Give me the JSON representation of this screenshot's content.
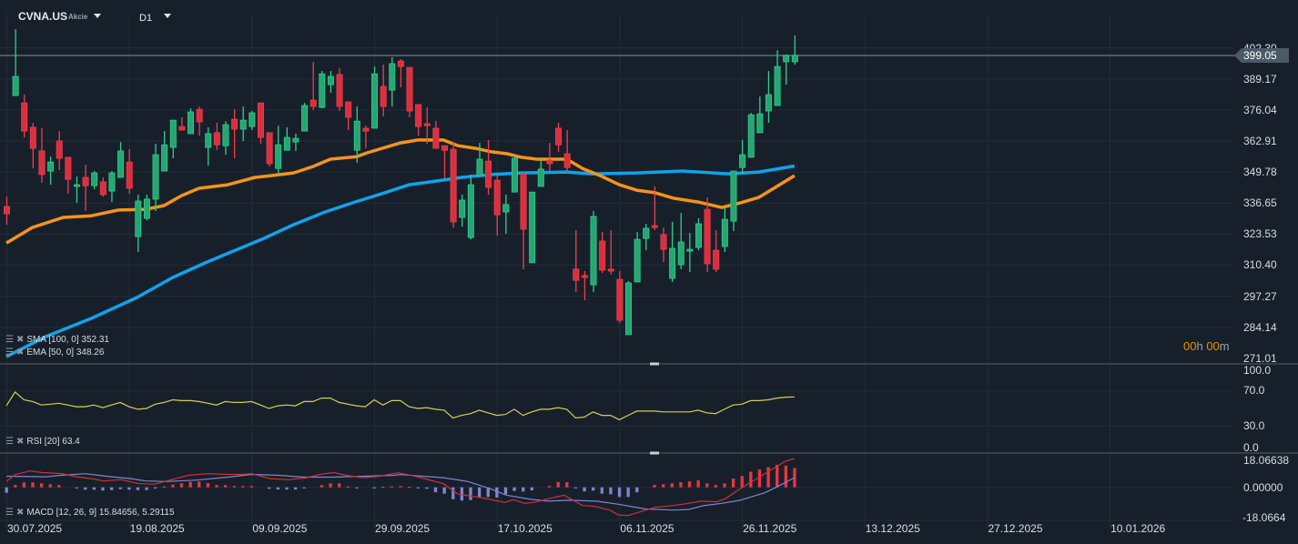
{
  "header": {
    "symbol": "CVNA.US",
    "type": "Akcie",
    "timeframe": "D1"
  },
  "current_price": "399.05",
  "timer": {
    "hours": "00",
    "h": "h",
    "minutes": "00",
    "m": "m"
  },
  "legends": {
    "sma": "SMA [100, 0] 352.31",
    "ema": "EMA [50, 0] 348.26",
    "rsi": "RSI [20] 63.4",
    "macd": "MACD [12, 26, 9] 15.84656,  5.29115"
  },
  "colors": {
    "bg": "#17202a",
    "up": "#26a673",
    "down": "#d9303f",
    "ema": "#f7931a",
    "sma": "#0fa3ec",
    "rsi": "#d6cc5a",
    "macd": "#d32f3a",
    "signal": "#7f86d0"
  },
  "chart_data": {
    "type": "candlestick",
    "title": "CVNA.US D1",
    "price_axis": {
      "ticks": [
        "402.30",
        "389.17",
        "376.04",
        "362.91",
        "349.78",
        "336.65",
        "323.53",
        "310.40",
        "297.27",
        "284.14",
        "271.01"
      ],
      "range": [
        271.01,
        402.3
      ]
    },
    "x_axis": {
      "labels": [
        {
          "i": 0,
          "label": "30.07.2025"
        },
        {
          "i": 14,
          "label": "19.08.2025"
        },
        {
          "i": 28,
          "label": "09.09.2025"
        },
        {
          "i": 42,
          "label": "29.09.2025"
        },
        {
          "i": 56,
          "label": "17.10.2025"
        },
        {
          "i": 70,
          "label": "06.11.2025"
        },
        {
          "i": 84,
          "label": "26.11.2025"
        },
        {
          "i": 98,
          "label": "13.12.2025"
        },
        {
          "i": 112,
          "label": "27.12.2025"
        },
        {
          "i": 126,
          "label": "10.01.2026"
        }
      ]
    },
    "ohlc": [
      [
        335.2,
        339.4,
        327.5,
        332.1
      ],
      [
        382.1,
        410.2,
        382.1,
        390.2
      ],
      [
        379.0,
        382.5,
        364.4,
        367.1
      ],
      [
        368.7,
        370.6,
        351.3,
        359.8
      ],
      [
        358.7,
        368.3,
        345.2,
        348.7
      ],
      [
        350.2,
        356.3,
        344.4,
        354.0
      ],
      [
        362.9,
        367.1,
        350.6,
        355.6
      ],
      [
        356.0,
        356.0,
        340.6,
        346.7
      ],
      [
        343.7,
        347.9,
        336.7,
        344.4
      ],
      [
        347.5,
        352.9,
        333.3,
        344.0
      ],
      [
        344.0,
        350.2,
        342.5,
        349.4
      ],
      [
        345.6,
        347.5,
        339.4,
        340.2
      ],
      [
        341.7,
        350.2,
        337.1,
        349.4
      ],
      [
        347.5,
        362.5,
        347.5,
        358.7
      ],
      [
        354.0,
        359.4,
        340.6,
        342.9
      ],
      [
        322.5,
        340.2,
        316.0,
        337.5
      ],
      [
        330.2,
        340.2,
        329.4,
        338.3
      ],
      [
        338.3,
        361.7,
        333.3,
        357.1
      ],
      [
        350.2,
        367.1,
        350.2,
        361.3
      ],
      [
        360.2,
        371.7,
        355.6,
        371.7
      ],
      [
        369.0,
        372.9,
        367.5,
        367.5
      ],
      [
        366.0,
        376.7,
        366.0,
        375.2
      ],
      [
        376.3,
        377.5,
        365.2,
        371.0
      ],
      [
        360.2,
        368.7,
        352.5,
        366.0
      ],
      [
        366.4,
        370.6,
        359.0,
        361.3
      ],
      [
        360.9,
        371.3,
        357.1,
        369.8
      ],
      [
        372.1,
        376.3,
        355.6,
        367.9
      ],
      [
        367.9,
        377.5,
        362.9,
        371.7
      ],
      [
        369.0,
        375.6,
        367.5,
        374.8
      ],
      [
        379.0,
        379.0,
        361.7,
        364.4
      ],
      [
        366.4,
        366.4,
        352.1,
        353.3
      ],
      [
        351.3,
        369.4,
        348.7,
        361.3
      ],
      [
        359.0,
        368.7,
        359.0,
        364.4
      ],
      [
        362.5,
        366.0,
        358.7,
        364.0
      ],
      [
        367.1,
        379.0,
        367.1,
        377.9
      ],
      [
        380.2,
        396.3,
        376.0,
        377.5
      ],
      [
        377.1,
        392.5,
        376.7,
        391.3
      ],
      [
        386.7,
        392.5,
        383.3,
        390.2
      ],
      [
        391.0,
        393.7,
        375.6,
        377.5
      ],
      [
        379.4,
        379.4,
        367.5,
        372.9
      ],
      [
        359.0,
        377.5,
        353.7,
        371.3
      ],
      [
        368.3,
        369.4,
        359.8,
        367.1
      ],
      [
        368.3,
        394.4,
        368.3,
        391.3
      ],
      [
        386.0,
        395.2,
        373.3,
        377.5
      ],
      [
        384.4,
        398.3,
        377.5,
        395.6
      ],
      [
        396.7,
        397.5,
        385.6,
        394.4
      ],
      [
        394.0,
        394.0,
        372.9,
        375.6
      ],
      [
        378.3,
        378.3,
        365.2,
        369.0
      ],
      [
        370.2,
        377.1,
        361.7,
        369.4
      ],
      [
        368.3,
        371.3,
        359.8,
        359.8
      ],
      [
        360.9,
        360.9,
        347.1,
        359.0
      ],
      [
        359.4,
        362.5,
        326.3,
        328.7
      ],
      [
        330.6,
        340.2,
        326.7,
        337.9
      ],
      [
        322.1,
        348.7,
        321.3,
        344.4
      ],
      [
        348.3,
        362.1,
        348.3,
        355.2
      ],
      [
        354.4,
        363.3,
        340.2,
        343.3
      ],
      [
        346.3,
        348.3,
        322.9,
        331.7
      ],
      [
        332.9,
        340.2,
        323.7,
        336.0
      ],
      [
        341.3,
        356.7,
        341.3,
        355.6
      ],
      [
        349.0,
        349.0,
        308.7,
        325.6
      ],
      [
        311.4,
        341.3,
        311.4,
        341.3
      ],
      [
        343.7,
        356.0,
        343.7,
        351.0
      ],
      [
        354.8,
        362.1,
        350.2,
        353.3
      ],
      [
        368.3,
        370.6,
        358.3,
        361.3
      ],
      [
        357.5,
        367.5,
        349.4,
        351.7
      ],
      [
        308.7,
        325.2,
        299.0,
        304.0
      ],
      [
        306.0,
        307.9,
        295.6,
        305.2
      ],
      [
        302.1,
        333.3,
        299.0,
        331.0
      ],
      [
        320.6,
        324.4,
        307.1,
        308.3
      ],
      [
        308.7,
        325.2,
        306.4,
        307.9
      ],
      [
        304.4,
        307.9,
        286.0,
        287.1
      ],
      [
        281.0,
        303.7,
        281.0,
        302.9
      ],
      [
        303.3,
        324.4,
        303.3,
        321.3
      ],
      [
        321.7,
        327.9,
        316.7,
        326.0
      ],
      [
        327.1,
        343.7,
        325.2,
        326.3
      ],
      [
        323.3,
        326.3,
        311.7,
        317.1
      ],
      [
        304.8,
        328.7,
        303.3,
        317.5
      ],
      [
        310.6,
        332.5,
        308.7,
        320.2
      ],
      [
        316.3,
        324.0,
        307.5,
        317.1
      ],
      [
        317.9,
        330.2,
        316.7,
        327.9
      ],
      [
        334.0,
        339.0,
        307.5,
        311.0
      ],
      [
        316.7,
        325.2,
        307.5,
        308.7
      ],
      [
        318.3,
        334.4,
        316.0,
        329.8
      ],
      [
        329.0,
        350.2,
        324.8,
        350.2
      ],
      [
        351.7,
        363.3,
        349.0,
        357.1
      ],
      [
        356.0,
        374.8,
        356.0,
        374.0
      ],
      [
        366.4,
        381.7,
        366.4,
        374.4
      ],
      [
        375.6,
        392.5,
        370.6,
        382.5
      ],
      [
        377.9,
        401.3,
        377.9,
        394.4
      ],
      [
        396.4,
        399.5,
        386.7,
        399.05
      ],
      [
        396.4,
        407.5,
        395.2,
        399.05
      ]
    ],
    "ema50": [
      [
        0,
        319.8
      ],
      [
        3,
        326.4
      ],
      [
        6.5,
        330.6
      ],
      [
        9.7,
        331.3
      ],
      [
        12.8,
        333.7
      ],
      [
        15.9,
        334.0
      ],
      [
        18,
        335.6
      ],
      [
        20,
        339.8
      ],
      [
        22,
        342.9
      ],
      [
        25.3,
        344.4
      ],
      [
        28.4,
        347.5
      ],
      [
        29.4,
        347.9
      ],
      [
        32.8,
        349.4
      ],
      [
        35,
        352.1
      ],
      [
        37,
        355.2
      ],
      [
        40,
        356.3
      ],
      [
        41.2,
        357.9
      ],
      [
        45,
        362.1
      ],
      [
        47,
        363.3
      ],
      [
        49.9,
        363.3
      ],
      [
        51.6,
        360.9
      ],
      [
        53.6,
        359.8
      ],
      [
        55.4,
        358.3
      ],
      [
        57.2,
        357.5
      ],
      [
        58.8,
        356.0
      ],
      [
        60.6,
        355.2
      ],
      [
        64,
        355.2
      ],
      [
        65.8,
        351.3
      ],
      [
        67.8,
        348.3
      ],
      [
        70,
        344.4
      ],
      [
        72,
        342.1
      ],
      [
        74.1,
        341.0
      ],
      [
        76.2,
        338.7
      ],
      [
        79,
        337.1
      ],
      [
        81.7,
        334.8
      ],
      [
        83.8,
        336.7
      ],
      [
        85.9,
        339.0
      ],
      [
        88,
        343.7
      ],
      [
        90,
        348.26
      ]
    ],
    "sma100": [
      [
        0,
        271.7
      ],
      [
        4.5,
        280.2
      ],
      [
        9.7,
        287.9
      ],
      [
        14.9,
        296.7
      ],
      [
        19,
        305.2
      ],
      [
        22.9,
        311.7
      ],
      [
        29.4,
        321.7
      ],
      [
        32.8,
        327.5
      ],
      [
        36.4,
        332.9
      ],
      [
        39.8,
        337.1
      ],
      [
        43.2,
        341.0
      ],
      [
        46,
        344.4
      ],
      [
        48.4,
        345.6
      ],
      [
        52,
        347.5
      ],
      [
        55.4,
        348.7
      ],
      [
        58.8,
        349.4
      ],
      [
        64,
        349.8
      ],
      [
        66.8,
        349.0
      ],
      [
        72,
        349.4
      ],
      [
        77.2,
        350.2
      ],
      [
        82.4,
        349.0
      ],
      [
        85.9,
        349.8
      ],
      [
        90,
        352.31
      ]
    ],
    "rsi": {
      "ticks": [
        "100.0",
        "70.0",
        "30.0",
        "0.0"
      ],
      "range": [
        0,
        100
      ],
      "values": [
        53,
        69,
        60,
        58,
        54,
        55,
        56,
        54,
        52,
        52,
        54,
        51,
        54,
        57,
        52,
        49,
        50,
        55,
        57,
        60,
        59,
        59,
        58,
        56,
        54,
        58,
        57,
        57,
        58,
        54,
        50,
        53,
        54,
        53,
        58,
        58,
        62,
        62,
        57,
        55,
        53,
        52,
        60,
        54,
        59,
        59,
        52,
        50,
        51,
        49,
        48,
        39,
        42,
        44,
        48,
        45,
        42,
        43,
        49,
        42,
        46,
        49,
        49,
        51,
        49,
        39,
        40,
        46,
        42,
        42,
        37,
        42,
        47,
        47,
        47,
        46,
        46,
        46,
        46,
        48,
        45,
        44,
        49,
        54,
        55,
        59,
        59,
        60,
        62,
        63,
        63.4
      ]
    },
    "macd": {
      "ticks": [
        "18.06638",
        "0.00000",
        "-18.0664"
      ],
      "range": [
        -18.0664,
        18.06638
      ],
      "macd": [
        [
          0,
          3.2
        ],
        [
          1,
          7.0
        ],
        [
          2.7,
          9.0
        ],
        [
          4.1,
          8.1
        ],
        [
          6.2,
          7.6
        ],
        [
          8.3,
          5.6
        ],
        [
          9.7,
          4.8
        ],
        [
          11.1,
          3.5
        ],
        [
          13.1,
          4.2
        ],
        [
          15.2,
          2.0
        ],
        [
          16.9,
          1.7
        ],
        [
          18.7,
          4.0
        ],
        [
          20.8,
          6.6
        ],
        [
          22.8,
          7.5
        ],
        [
          25.3,
          7.1
        ],
        [
          27,
          7.1
        ],
        [
          28,
          7.5
        ],
        [
          30.1,
          4.8
        ],
        [
          32.2,
          4.2
        ],
        [
          34.3,
          5.3
        ],
        [
          36,
          7.3
        ],
        [
          37.4,
          8.1
        ],
        [
          38.8,
          6.6
        ],
        [
          40.8,
          5.3
        ],
        [
          42.6,
          6.1
        ],
        [
          44.7,
          8.0
        ],
        [
          46,
          6.8
        ],
        [
          47.1,
          5.6
        ],
        [
          49.9,
          2.0
        ],
        [
          51.6,
          -3.8
        ],
        [
          54,
          -5.5
        ],
        [
          55.7,
          -7.1
        ],
        [
          56.9,
          -8.3
        ],
        [
          57.9,
          -6.8
        ],
        [
          59.2,
          -8.8
        ],
        [
          60.2,
          -8.3
        ],
        [
          61.9,
          -6.3
        ],
        [
          63.7,
          -4.3
        ],
        [
          65.8,
          -10.0
        ],
        [
          67.2,
          -10.5
        ],
        [
          68.9,
          -12.5
        ],
        [
          69.9,
          -15.2
        ],
        [
          71,
          -15.5
        ],
        [
          72.7,
          -13.0
        ],
        [
          74.1,
          -11.0
        ],
        [
          76.2,
          -10.0
        ],
        [
          77.9,
          -8.8
        ],
        [
          79.3,
          -7.6
        ],
        [
          81.1,
          -8.0
        ],
        [
          82.1,
          -6.3
        ],
        [
          83.8,
          -0.8
        ],
        [
          85.6,
          4.5
        ],
        [
          87.3,
          9.5
        ],
        [
          88.9,
          14.2
        ],
        [
          90,
          15.85
        ]
      ],
      "signal": [
        [
          0,
          6.1
        ],
        [
          4.5,
          5.8
        ],
        [
          6.2,
          6.6
        ],
        [
          9,
          7.5
        ],
        [
          11.4,
          6.1
        ],
        [
          14.2,
          4.8
        ],
        [
          15.9,
          3.5
        ],
        [
          18.3,
          3.2
        ],
        [
          21.8,
          4.0
        ],
        [
          25.3,
          5.6
        ],
        [
          28,
          7.1
        ],
        [
          31.1,
          6.6
        ],
        [
          34,
          5.6
        ],
        [
          37.4,
          5.6
        ],
        [
          40.8,
          6.1
        ],
        [
          44.3,
          6.6
        ],
        [
          45,
          7.0
        ],
        [
          49.9,
          5.3
        ],
        [
          52.7,
          3.2
        ],
        [
          55.4,
          -1.0
        ],
        [
          57.1,
          -4.3
        ],
        [
          59.9,
          -6.6
        ],
        [
          61.9,
          -7.6
        ],
        [
          64.3,
          -7.1
        ],
        [
          67.4,
          -7.6
        ],
        [
          69.9,
          -9.3
        ],
        [
          73,
          -11.9
        ],
        [
          76.2,
          -12.5
        ],
        [
          77.9,
          -12.2
        ],
        [
          79.6,
          -10.1
        ],
        [
          81.7,
          -8.8
        ],
        [
          83.8,
          -7.1
        ],
        [
          86.6,
          -3.0
        ],
        [
          87.9,
          0
        ],
        [
          90,
          5.29
        ]
      ],
      "histogram": [
        -3.0,
        1.3,
        2.7,
        2.7,
        2.2,
        1.7,
        1.3,
        0,
        -0.5,
        -1.3,
        -1.3,
        -1.8,
        -1.5,
        -1.0,
        -1.3,
        -1.5,
        -1.5,
        -0.7,
        0.5,
        1.5,
        2.2,
        3.0,
        3.2,
        2.3,
        1.3,
        1.2,
        0.7,
        0.7,
        0.7,
        0,
        -0.8,
        -1.2,
        -1.2,
        -1.2,
        -0.3,
        0,
        1.2,
        2.2,
        2.2,
        0.5,
        -0.3,
        0,
        -0.3,
        0.3,
        0.5,
        0.7,
        0.3,
        -0.5,
        -0.8,
        -2.7,
        -3.5,
        -6.5,
        -7.3,
        -7.0,
        -5.6,
        -5.3,
        -5.6,
        -3.7,
        -2.0,
        -2.3,
        -1.7,
        0,
        0.7,
        3.0,
        2.8,
        -0.3,
        -2.2,
        -1.8,
        -3.5,
        -3.8,
        -5.3,
        -5.3,
        -2.7,
        0,
        1.3,
        1.7,
        2.2,
        2.8,
        3.3,
        3.8,
        2.2,
        1.3,
        2.2,
        4.8,
        6.3,
        8.6,
        9.8,
        11.1,
        12.4,
        11.9,
        10.6
      ]
    }
  }
}
